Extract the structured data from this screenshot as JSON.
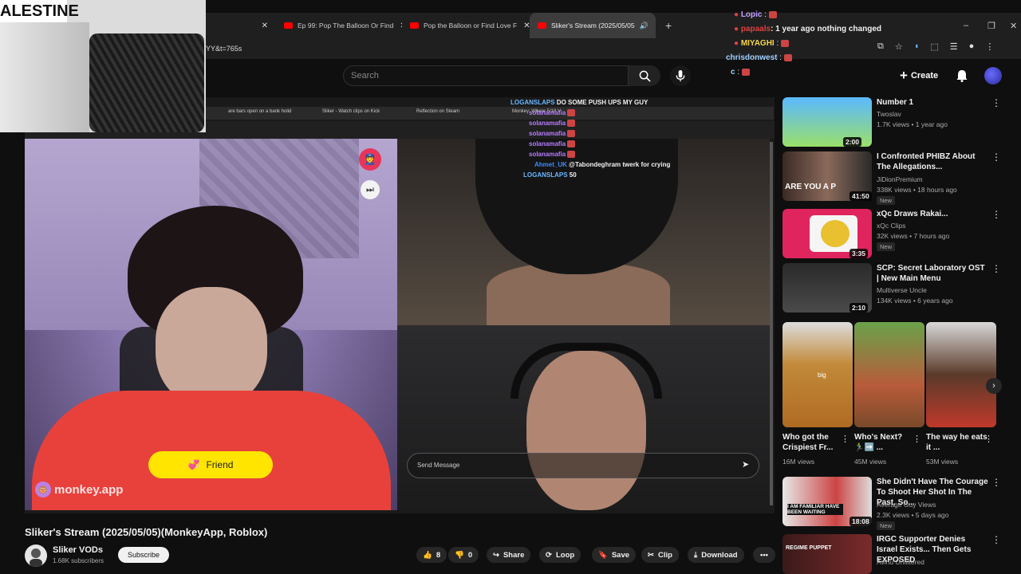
{
  "browser": {
    "tabs": [
      {
        "label": "Ep 99: Pop The Balloon Or Find",
        "active": false
      },
      {
        "label": "Pop the Balloon or Find Love F",
        "active": false
      },
      {
        "label": "Sliker's Stream (2025/05/05",
        "active": true
      }
    ],
    "new_tab": "+",
    "url": "YY&t=765s",
    "window_controls": {
      "minimize": "–",
      "maximize": "❐",
      "close": "✕"
    }
  },
  "youtube": {
    "search_placeholder": "Search",
    "create_label": "Create"
  },
  "inner_browser": {
    "tabs": [
      "are bars open on a bank holid",
      "Sliker - Watch clips on Kick",
      "Reflection on Steam",
      "Monkey: Where 5/18 V"
    ]
  },
  "overlay_chat_inner": [
    {
      "user": "LOGANSLAPS",
      "msg": "DO SOME PUSH UPS MY GUY",
      "color": "#6ab7ff"
    },
    {
      "user": "solanamafia",
      "msg": "",
      "color": "#b87cff"
    },
    {
      "user": "solanamafia",
      "msg": "",
      "color": "#b87cff"
    },
    {
      "user": "solanamafia",
      "msg": "",
      "color": "#b87cff"
    },
    {
      "user": "solanamafia",
      "msg": "",
      "color": "#b87cff"
    },
    {
      "user": "solanamafia",
      "msg": "",
      "color": "#b87cff"
    },
    {
      "user": "Ahmet_UK",
      "msg": "@Tabondeghram twerk for crying",
      "color": "#3b8bff"
    },
    {
      "user": "LOGANSLAPS",
      "msg": "50",
      "color": "#6ab7ff"
    }
  ],
  "overlay_chat_outer": [
    {
      "user": "Lopic",
      "msg": ":",
      "color": "#c2a0ff"
    },
    {
      "user": "papaals",
      "msg": ": 1 year ago nothing changed",
      "color": "#e04040"
    },
    {
      "user": "MIYAGHI",
      "msg": ":",
      "color": "#f5d64a"
    },
    {
      "user": "chrisdonwest",
      "msg": ":",
      "color": "#9fd0ff"
    },
    {
      "user": "c",
      "msg": ":",
      "color": "#9fd0ff"
    }
  ],
  "streamer_webcam": {
    "sign_text": "ALESTINE"
  },
  "video": {
    "friend_label": "Friend",
    "brand": "monkey.app",
    "send_placeholder": "Send Message",
    "title": "Sliker's Stream (2025/05/05)(MonkeyApp, Roblox)"
  },
  "channel": {
    "name": "Sliker VODs",
    "subs": "1.68K subscribers",
    "subscribe": "Subscribe"
  },
  "actions": {
    "likes": "8",
    "dislikes": "0",
    "share": "Share",
    "loop": "Loop",
    "save": "Save",
    "clip": "Clip",
    "download": "Download",
    "more": "•••"
  },
  "sidebar": [
    {
      "title": "Number 1",
      "channel": "Twoslav",
      "views": "1.7K views • 1 year ago",
      "duration": "2:00",
      "new": ""
    },
    {
      "title": "I Confronted PHIBZ About The Allegations...",
      "channel": "JiDionPremium",
      "views": "338K views • 18 hours ago",
      "duration": "41:50",
      "new": "New",
      "thumb_text": "ARE YOU A P"
    },
    {
      "title": "xQc Draws Rakai...",
      "channel": "xQc Clips",
      "views": "32K views • 7 hours ago",
      "duration": "3:35",
      "new": "New"
    },
    {
      "title": "SCP: Secret Laboratory OST | New Main Menu",
      "channel": "Multiverse Uncle",
      "views": "134K views • 6 years ago",
      "duration": "2:10",
      "new": ""
    }
  ],
  "shorts": [
    {
      "title": "Who got the Crispiest Fr...",
      "views": "16M views",
      "overlay": "big"
    },
    {
      "title": "Who's Next? 🏃‍♂️➡️ ...",
      "views": "45M views"
    },
    {
      "title": "The way he eats it ...",
      "views": "53M views"
    }
  ],
  "sidebar2": [
    {
      "title": "She Didn't Have The Courage To Shoot Her Shot In The Past, So...",
      "channel": "Average Guy Views",
      "views": "2.3K views • 5 days ago",
      "duration": "18:08",
      "new": "New",
      "thumb_text": "I AM FAMILIAR HAVE BEEN WAITING"
    },
    {
      "title": "IRGC Supporter Denies Israel Exists... Then Gets EXPOSED",
      "channel": "Avihu Unfiltered",
      "views": "",
      "thumb_text": "REGIME PUPPET"
    }
  ],
  "colors": {
    "youtube_red": "#ff0000",
    "friend_yellow": "#ffe500",
    "brand_purple": "#b68cff"
  }
}
